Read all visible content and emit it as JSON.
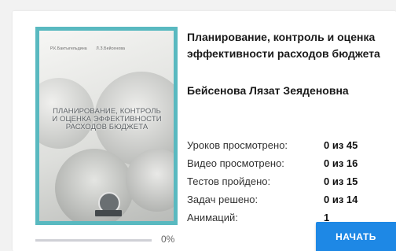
{
  "course": {
    "title": "Планирование, контроль и оценка эффективности расходов бюджета",
    "author": "Бейсенова Лязат Зеяденовна",
    "cover": {
      "authors": [
        "Р.К.Бактыгельдина",
        "Л.З.Бейсенова"
      ],
      "title": "ПЛАНИРОВАНИЕ, КОНТРОЛЬ И ОЦЕНКА ЭФФЕКТИВНОСТИ РАСХОДОВ БЮДЖЕТА",
      "frame_color": "#59b9c0"
    },
    "progress": {
      "fraction": 0.0,
      "text": "0%"
    },
    "stats": [
      {
        "label": "Уроков просмотрено:",
        "value": "0 из 45"
      },
      {
        "label": "Видео просмотрено:",
        "value": "0 из 16"
      },
      {
        "label": "Тестов пройдено:",
        "value": "0 из 15"
      },
      {
        "label": "Задач решено:",
        "value": "0 из 14"
      },
      {
        "label": "Анимаций:",
        "value": "1"
      }
    ],
    "start_label": "НАЧАТЬ",
    "accent_color": "#1e88e5"
  }
}
